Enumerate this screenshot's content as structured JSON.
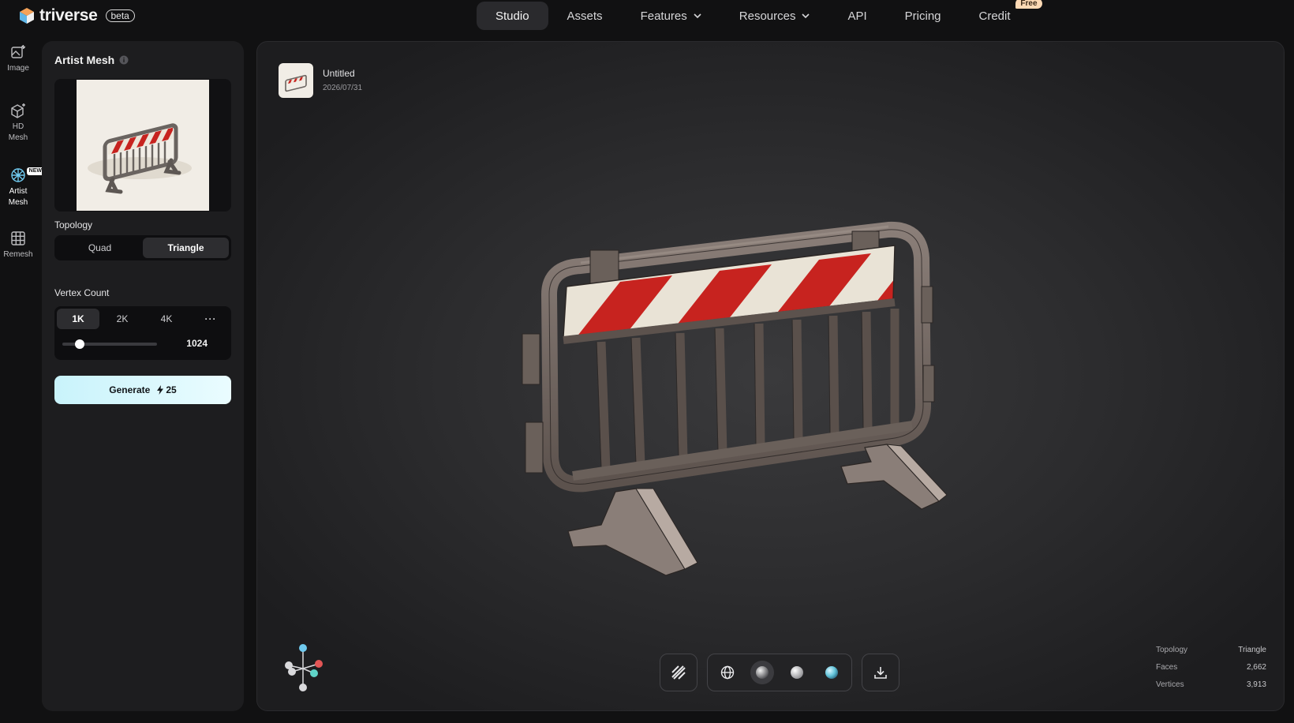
{
  "brand": {
    "name": "triverse",
    "badge": "beta"
  },
  "nav": {
    "items": [
      {
        "label": "Studio",
        "active": true
      },
      {
        "label": "Assets"
      },
      {
        "label": "Features",
        "dropdown": true
      },
      {
        "label": "Resources",
        "dropdown": true
      },
      {
        "label": "API"
      },
      {
        "label": "Pricing"
      },
      {
        "label": "Credit",
        "badge": "Free"
      }
    ]
  },
  "rail": {
    "image": "Image",
    "hd_mesh": "HD Mesh",
    "artist_mesh": "Artist Mesh",
    "artist_mesh_badge": "NEW",
    "remesh": "Remesh"
  },
  "panel": {
    "title": "Artist Mesh",
    "topology_label": "Topology",
    "topology_options": [
      "Quad",
      "Triangle"
    ],
    "topology_selected": "Triangle",
    "vertex_label": "Vertex Count",
    "vertex_options": [
      "1K",
      "2K",
      "4K"
    ],
    "vertex_selected": "1K",
    "vertex_more": "···",
    "vertex_value": "1024",
    "vertex_slider_fraction": 0.18,
    "generate_label": "Generate",
    "generate_cost": "25"
  },
  "viewer": {
    "file_name": "Untitled",
    "file_date": "2026/07/31",
    "stats": [
      {
        "label": "Topology",
        "value": "Triangle"
      },
      {
        "label": "Faces",
        "value": "2,662"
      },
      {
        "label": "Vertices",
        "value": "3,913"
      }
    ]
  },
  "colors": {
    "accent": "#c9f3fb",
    "stripe_red": "#c7231f",
    "stripe_white": "#e9e3d6"
  }
}
